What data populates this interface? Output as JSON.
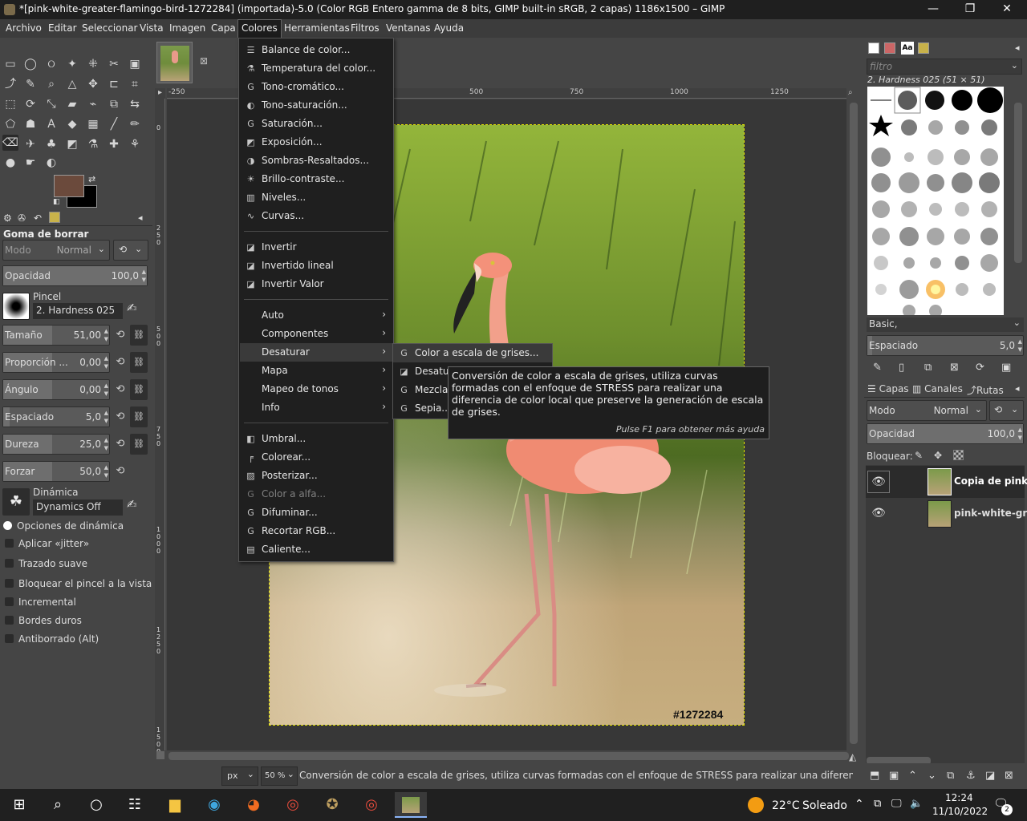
{
  "window": {
    "title": "*[pink-white-greater-flamingo-bird-1272284] (importada)-5.0 (Color RGB Entero gamma de 8 bits, GIMP built-in sRGB, 2 capas) 1186x1500 – GIMP",
    "minimize": "—",
    "restore": "❐",
    "close": "✕"
  },
  "menubar": [
    "Archivo",
    "Editar",
    "Seleccionar",
    "Vista",
    "Imagen",
    "Capa",
    "Colores",
    "Herramientas",
    "Filtros",
    "Ventanas",
    "Ayuda"
  ],
  "colors_menu": {
    "group1": [
      "Balance de color...",
      "Temperatura del color...",
      "Tono-cromático...",
      "Tono-saturación...",
      "Saturación...",
      "Exposición...",
      "Sombras-Resaltados...",
      "Brillo-contraste...",
      "Niveles...",
      "Curvas..."
    ],
    "group2": [
      "Invertir",
      "Invertido lineal",
      "Invertir Valor"
    ],
    "group3": [
      "Auto",
      "Componentes",
      "Desaturar",
      "Mapa",
      "Mapeo de tonos",
      "Info"
    ],
    "group4": [
      "Umbral...",
      "Colorear...",
      "Posterizar...",
      "Color a alfa...",
      "Difuminar...",
      "Recortar RGB...",
      "Caliente..."
    ]
  },
  "desaturate_submenu": [
    "Color a escala de grises...",
    "Desaturar...",
    "Mezclador mono...",
    "Sepia..."
  ],
  "tooltip": {
    "text": "Conversión de color a escala de grises, utiliza curvas formadas con el enfoque de STRESS para realizar una diferencia de color local que preserve la generación de escala de grises.",
    "help": "Pulse F1 para obtener más ayuda"
  },
  "tool_options": {
    "title": "Goma de borrar",
    "mode_label": "Modo",
    "mode_value": "Normal",
    "opacity_label": "Opacidad",
    "opacity_value": "100,0",
    "brush_label": "Pincel",
    "brush_value": "2. Hardness 025",
    "size_label": "Tamaño",
    "size_value": "51,00",
    "ratio_label": "Proporción ...",
    "ratio_value": "0,00",
    "angle_label": "Ángulo",
    "angle_value": "0,00",
    "spacing_label": "Espaciado",
    "spacing_value": "5,0",
    "hardness_label": "Dureza",
    "hardness_value": "25,0",
    "force_label": "Forzar",
    "force_value": "50,0",
    "dynamics_label": "Dinámica",
    "dynamics_value": "Dynamics Off",
    "checkboxes": [
      "Opciones de dinámica",
      "Aplicar «jitter»",
      "Trazado suave",
      "Bloquear el pincel a la vista",
      "Incremental",
      "Bordes duros",
      "Antiborrado  (Alt)"
    ]
  },
  "ruler": {
    "h_marks": [
      "-250",
      "500",
      "750",
      "1000",
      "1250"
    ],
    "v_marks": [
      "0",
      "2 5 0",
      "5 0 0",
      "7 5 0",
      "1 0 0 0",
      "1 2 5 0",
      "1 5 0 0"
    ]
  },
  "image": {
    "watermark": "#1272284"
  },
  "brushes": {
    "filter_placeholder": "filtro",
    "selected": "2. Hardness 025 (51 × 51)",
    "tag": "Basic,",
    "spacing_label": "Espaciado",
    "spacing_value": "5,0"
  },
  "layers": {
    "tabs": [
      "Capas",
      "Canales",
      "Rutas"
    ],
    "mode_label": "Modo",
    "mode_value": "Normal",
    "opacity_label": "Opacidad",
    "opacity_value": "100,0",
    "lock_label": "Bloquear:",
    "items": [
      "Copia de pink",
      "pink-white-gr"
    ]
  },
  "statusbar": {
    "unit": "px",
    "zoom": "50 %",
    "message": "Conversión de color a escala de grises, utiliza curvas formadas con el enfoque de STRESS para realizar una diferencia de color loca..."
  },
  "taskbar": {
    "weather_temp": "22°C",
    "weather_text": "Soleado",
    "time": "12:24",
    "date": "11/10/2022",
    "notifications": "2"
  },
  "colors": {
    "foreground": "#6b4a3c",
    "background": "#000000"
  }
}
